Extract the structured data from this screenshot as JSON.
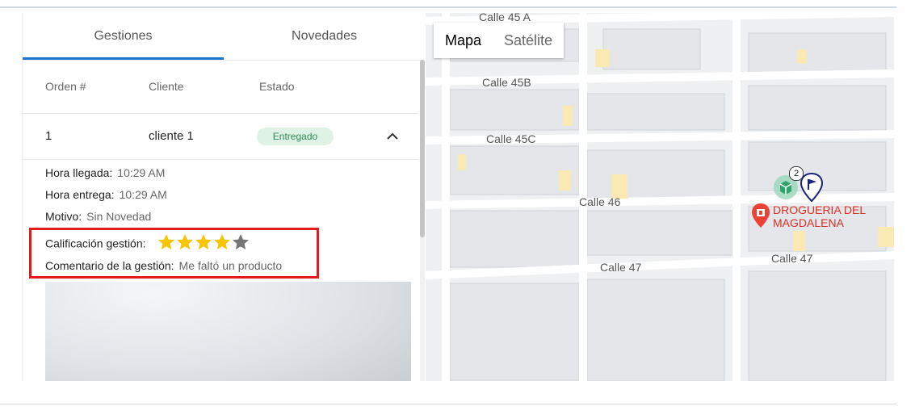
{
  "tabs": [
    {
      "label": "Gestiones",
      "active": true
    },
    {
      "label": "Novedades",
      "active": false
    }
  ],
  "table": {
    "headers": [
      "Orden #",
      "Cliente",
      "Estado"
    ],
    "row": {
      "orden": "1",
      "cliente": "cliente 1",
      "estado": "Entregado"
    }
  },
  "details": {
    "hora_llegada_label": "Hora llegada:",
    "hora_llegada": "10:29 AM",
    "hora_entrega_label": "Hora entrega:",
    "hora_entrega": "10:29 AM",
    "motivo_label": "Motivo:",
    "motivo": "Sin Novedad",
    "calificacion_label": "Calificación gestión:",
    "calificacion_stars": 4,
    "calificacion_max": 5,
    "comentario_label": "Comentario de la gestión:",
    "comentario": "Me faltó un producto"
  },
  "map": {
    "type_buttons": [
      {
        "label": "Mapa",
        "active": true
      },
      {
        "label": "Satélite",
        "active": false
      }
    ],
    "streets": [
      "Calle 45 A",
      "Calle 45B",
      "Calle 45C",
      "Calle 46",
      "Calle 47",
      "Calle 47"
    ],
    "poi_line1": "DROGUERIA DEL",
    "poi_line2": "MAGDALENA",
    "cluster_count": "2"
  },
  "colors": {
    "accent": "#1a73c8",
    "highlight_border": "#e21b1b",
    "badge_bg": "#dff2e6",
    "badge_text": "#2e8b57",
    "star_filled": "#f9c400",
    "star_empty": "#757575",
    "poi": "#d93025"
  }
}
